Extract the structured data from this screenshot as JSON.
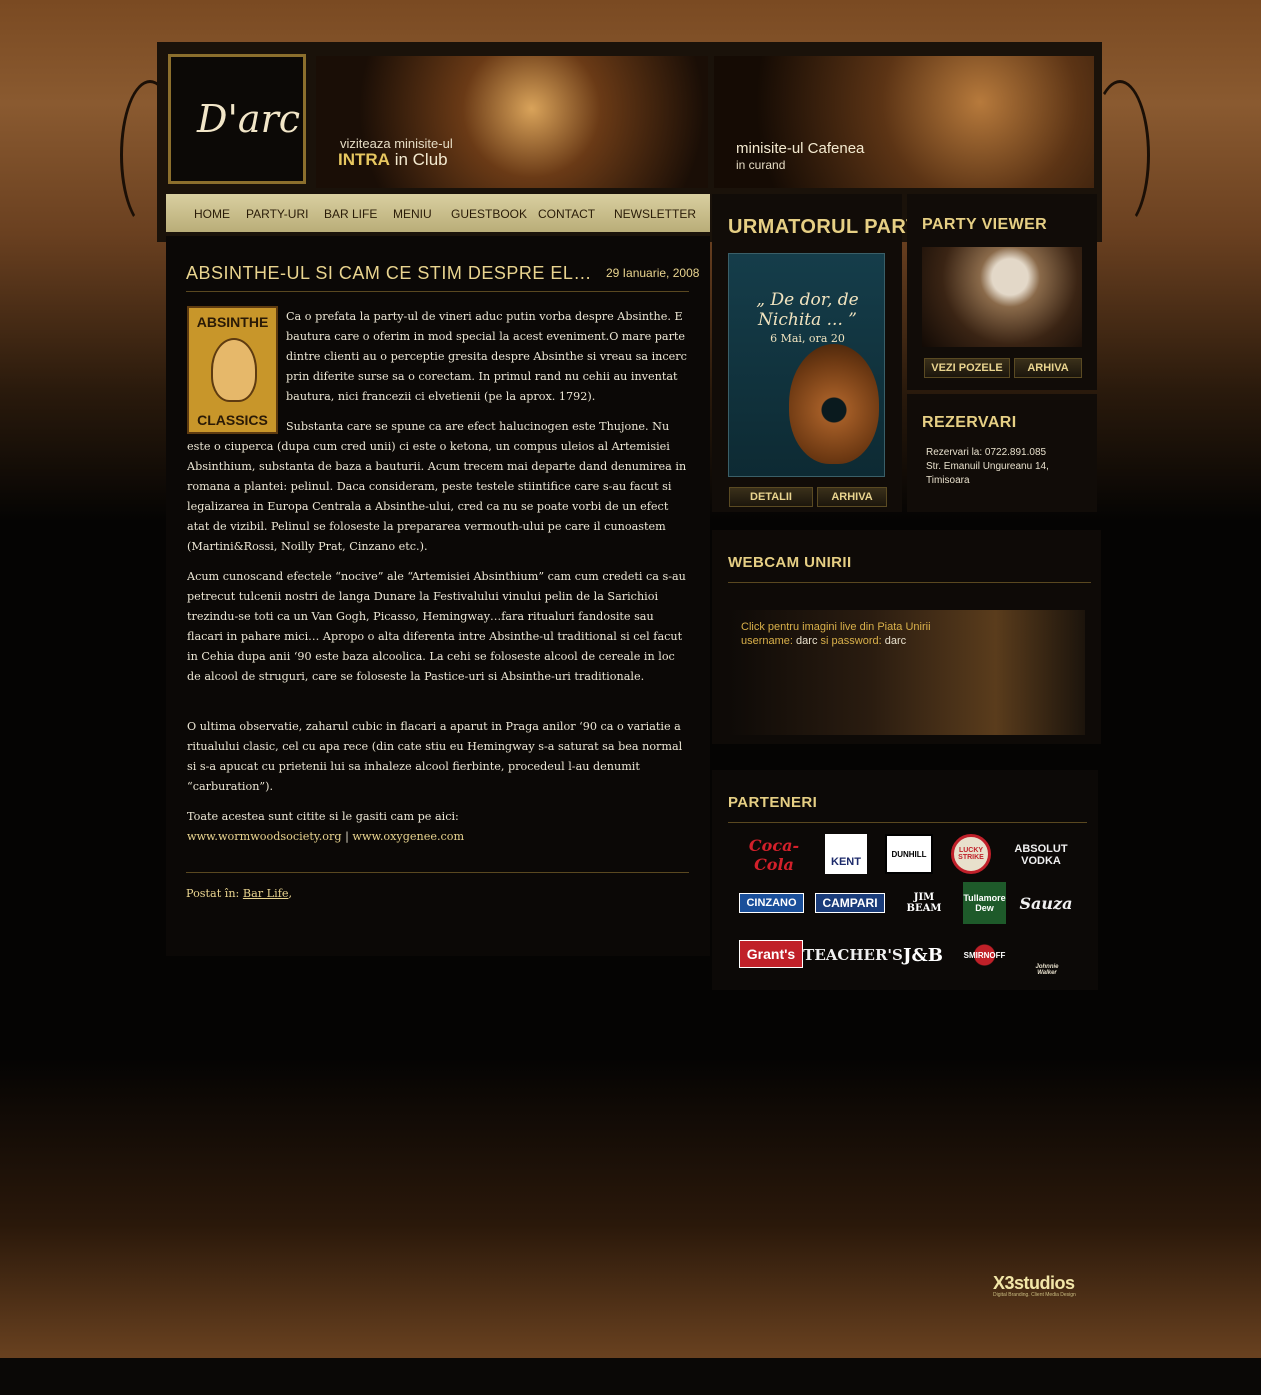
{
  "header": {
    "logo_text": "D'arc",
    "minisite_club": {
      "line1": "viziteaza minisite-ul",
      "highlight": "INTRA",
      "rest": "in Club"
    },
    "minisite_cafe": {
      "line1": "minisite-ul Cafenea",
      "line2": "in curand"
    }
  },
  "nav": {
    "items": [
      "HOME",
      "PARTY-URI",
      "BAR LIFE",
      "MENIU",
      "GUESTBOOK",
      "CONTACT",
      "NEWSLETTER"
    ]
  },
  "post": {
    "title": "ABSINTHE-UL SI CAM CE STIM DESPRE EL…",
    "date": "29 Ianuarie, 2008",
    "image_top": "ABSINTHE",
    "image_bottom": "CLASSICS",
    "paragraphs": [
      "Ca o prefata la party-ul de vineri aduc putin vorba despre Absinthe. E bautura care o oferim in mod special la acest eveniment.O mare parte dintre clienti au o perceptie gresita despre Absinthe si vreau sa incerc prin diferite surse sa o corectam. In primul rand nu cehii au inventat bautura, nici francezii ci elvetienii (pe la aprox. 1792).",
      "Substanta care se spune ca are efect halucinogen este Thujone. Nu este o ciuperca (dupa cum cred unii) ci este o ketona, un compus uleios al Artemisiei Absinthium, substanta de baza a bauturii. Acum trecem mai departe dand denumirea in romana a plantei: pelinul. Daca consideram, peste testele stiintifice care s-au facut si legalizarea in Europa Centrala a Absinthe-ului, cred ca nu se poate vorbi de un efect atat de vizibil. Pelinul se foloseste la prepararea vermouth-ului pe care il cunoastem (Martini&Rossi, Noilly Prat, Cinzano etc.).",
      "Acum cunoscand efectele “nocive” ale “Artemisiei Absinthium” cam cum credeti ca s-au petrecut tulcenii nostri de langa Dunare la Festivalului vinului pelin de la Sarichioi trezindu-se toti ca un Van Gogh, Picasso, Hemingway…fara ritualuri fandosite sau flacari in pahare mici… Apropo o alta diferenta intre Absinthe-ul traditional si cel facut in Cehia dupa anii ‘90 este baza alcoolica. La cehi se foloseste alcool de cereale in loc de alcool de struguri, care se foloseste la Pastice-uri si Absinthe-uri traditionale.",
      "O ultima observatie, zaharul cubic in flacari a aparut in Praga anilor ‘90 ca o variatie a ritualului clasic, cel cu apa rece (din cate stiu eu Hemingway s-a saturat sa bea normal si s-a apucat cu prietenii lui sa inhaleze alcool fierbinte, procedeul l-au denumit “carburation”).",
      "Toate acestea sunt citite si le gasiti cam pe aici:"
    ],
    "links": [
      "www.wormwoodsociety.org",
      "www.oxygenee.com"
    ],
    "link_separator": "|",
    "posted_label": "Postat în:",
    "posted_category": "Bar Life",
    "posted_suffix": ","
  },
  "next_party": {
    "title": "URMATORUL PARTY",
    "poster_title": "„ De dor, de Nichita ... ”",
    "poster_date": "6 Mai, ora 20",
    "btn_details": "DETALII",
    "btn_archive": "ARHIVA"
  },
  "party_viewer": {
    "title": "PARTY VIEWER",
    "btn_photos": "VEZI POZELE",
    "btn_archive": "ARHIVA"
  },
  "reservations": {
    "title": "REZERVARI",
    "line1": "Rezervari la: 0722.891.085",
    "line2": "Str. Emanuil Ungureanu 14,",
    "line3": "Timisoara"
  },
  "webcam": {
    "title": "WEBCAM UNIRII",
    "line1": "Click pentru imagini live din Piata Unirii",
    "user_label": "username:",
    "user_value": "darc",
    "pass_label": "si password:",
    "pass_value": "darc"
  },
  "partners": {
    "title": "PARTENERI",
    "logos": [
      "Coca-Cola",
      "KENT",
      "DUNHILL",
      "LUCKY STRIKE",
      "ABSOLUT VODKA",
      "CINZANO",
      "CAMPARI",
      "JIM BEAM",
      "Tullamore Dew",
      "Sauza",
      "Grant's",
      "TEACHER'S",
      "J&B",
      "SMIRNOFF",
      "Johnnie Walker"
    ]
  },
  "footer": {
    "brand": "X3studios",
    "tagline": "Digital Branding. Client Media Design"
  },
  "colors": {
    "accent_gold": "#e9d48f",
    "background_brown": "#7a4a22",
    "nav_bg": "#d9cfa0"
  }
}
